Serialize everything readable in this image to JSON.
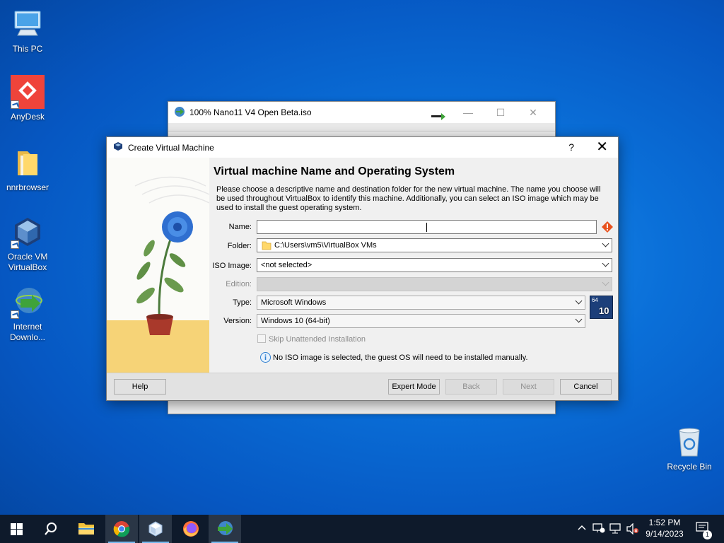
{
  "desktop": {
    "icons": [
      {
        "label": "This PC"
      },
      {
        "label": "AnyDesk"
      },
      {
        "label": "nnrbrowser"
      },
      {
        "label": "Oracle VM\nVirtualBox"
      },
      {
        "label": "Internet\nDownlo..."
      },
      {
        "label": "Recycle Bin"
      }
    ]
  },
  "background_window": {
    "title": "100% Nano11 V4 Open Beta.iso"
  },
  "dialog": {
    "title": "Create Virtual Machine",
    "help_glyph": "?",
    "close_glyph": "✕",
    "heading": "Virtual machine Name and Operating System",
    "description": "Please choose a descriptive name and destination folder for the new virtual machine. The name you choose will be used throughout VirtualBox to identify this machine. Additionally, you can select an ISO image which may be used to install the guest operating system.",
    "form": {
      "name_label": "Name:",
      "name_value": "",
      "folder_label": "Folder:",
      "folder_value": "C:\\Users\\vm5\\VirtualBox VMs",
      "iso_label": "ISO Image:",
      "iso_value": "<not selected>",
      "edition_label": "Edition:",
      "edition_value": "",
      "type_label": "Type:",
      "type_value": "Microsoft Windows",
      "version_label": "Version:",
      "version_value": "Windows 10 (64-bit)",
      "skip_label": "Skip Unattended Installation",
      "os_badge_bits": "64",
      "os_badge_version": "10",
      "info_text": "No ISO image is selected, the guest OS will need to be installed manually."
    },
    "buttons": {
      "help": "Help",
      "expert": "Expert Mode",
      "back": "Back",
      "next": "Next",
      "cancel": "Cancel"
    }
  },
  "taskbar": {
    "time": "1:52 PM",
    "date": "9/14/2023",
    "notification_count": "1"
  },
  "colors": {
    "accent": "#0a6fd8",
    "taskbar": "#0e1a2b",
    "error": "#e8521e"
  }
}
